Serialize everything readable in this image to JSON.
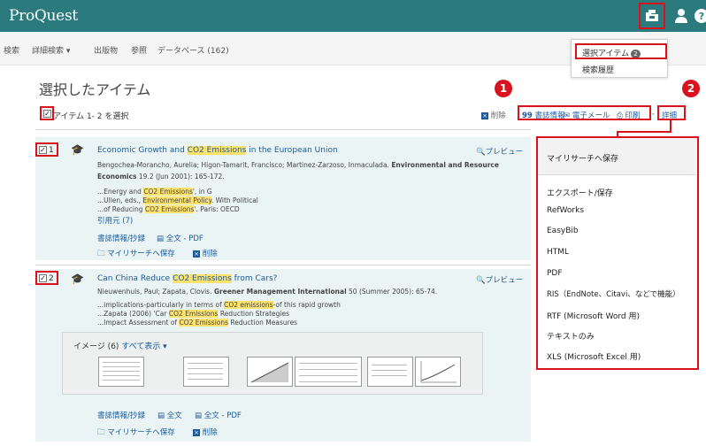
{
  "app": {
    "logo": "ProQuest"
  },
  "nav": {
    "items": [
      "検索",
      "詳細検索 ▾",
      "出版物",
      "参照",
      "データベース (162)"
    ]
  },
  "dropdown": {
    "selected_items": "選択アイテム",
    "selected_count": "2",
    "history": "検索履歴"
  },
  "page": {
    "title": "選択したアイテム",
    "select_label": "アイテム 1- 2 を選択"
  },
  "toolbar": {
    "delete": "削除",
    "citation": "書誌情報",
    "email": "電子メール",
    "print": "印刷",
    "sep": "-",
    "more": "詳細"
  },
  "callouts": {
    "one": "1",
    "two": "2"
  },
  "results": [
    {
      "num": "1",
      "title_pre": "Economic Growth and ",
      "title_hl": "CO2 Emissions",
      "title_post": " in the European Union",
      "meta1_plain": "Bengochea-Morancho, Aurelia; Higon-Tamarit, Francisco; Martinez-Zarzoso, Inmaculada. ",
      "meta1_bold": "Environmental and Resource",
      "meta2_bold": "Economics",
      "meta2_plain": " 19.2 (Jun 2001): 165-172.",
      "snip1_pre": "...Energy and ",
      "snip1_hl": "CO2 Emissions",
      "snip1_post": "', in G",
      "snip2_pre": "...Ullen, eds., ",
      "snip2_hl": "Environmental Policy",
      "snip2_post": ". With Political",
      "snip3_pre": "...of Reducing ",
      "snip3_hl": "CO2 Emissions",
      "snip3_post": "'. Paris: OECD",
      "cited": "引用元 (7)",
      "abstract": "書誌情報/抄録",
      "fulltext_pdf": "全文 - PDF",
      "save": "マイリサーチへ保存",
      "delete": "削除",
      "preview": "プレビュー"
    },
    {
      "num": "2",
      "title_pre": "Can China Reduce ",
      "title_hl": "CO2 Emissions",
      "title_post": " from Cars?",
      "meta1_plain": "Nieuwenhuis, Paul; Zapata, Clovis. ",
      "meta1_bold": "Greener Management International",
      "meta1_post": " 50  (Summer 2005): 65-74.",
      "snip1_pre": "...implications-particularly in terms of ",
      "snip1_hl": "CO2 emissions",
      "snip1_post": "-of this rapid growth",
      "snip2_pre": "...Zapata (2006) 'Car ",
      "snip2_hl": "CO2 Emissions",
      "snip2_post": " Reduction Strategies",
      "snip3_pre": "...Impact Assessment of ",
      "snip3_hl": "CO2 Emissions",
      "snip3_post": " Reduction Measures",
      "images_label": "イメージ (6)",
      "images_show_all": "すべて表示 ▾",
      "abstract": "書誌情報/抄録",
      "fulltext": "全文",
      "fulltext_pdf": "全文 - PDF",
      "save": "マイリサーチへ保存",
      "delete": "削除",
      "preview": "プレビュー"
    }
  ],
  "panel": {
    "header": "マイリサーチへ保存",
    "items": [
      "エクスポート/保存",
      "RefWorks",
      "EasyBib",
      "HTML",
      "PDF",
      "RIS（EndNote、Citavi、などで機能）",
      "RTF (Microsoft Word 用)",
      "テキストのみ",
      "XLS (Microsoft Excel 用)"
    ]
  },
  "colors": {
    "topbar": "#2a7a7e",
    "highlight": "#ffe26b",
    "link": "#1a5a9c",
    "callout": "#d9121e",
    "result_bg": "#eaf4f5"
  }
}
